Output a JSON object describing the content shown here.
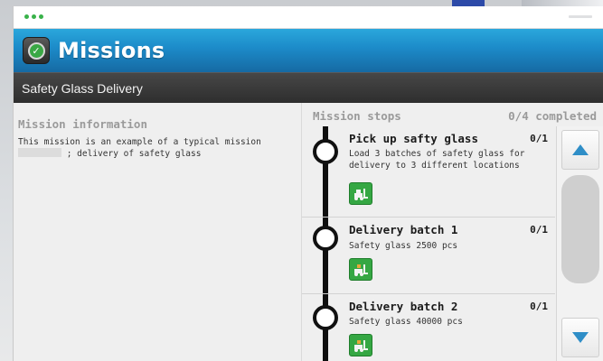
{
  "header": {
    "title": "Missions",
    "icon": "mission-check-icon",
    "accent": "#1c8ac8"
  },
  "subheader": {
    "title": "Safety Glass Delivery"
  },
  "mission_info": {
    "heading": "Mission information",
    "line1": "This mission is an example of a typical mission",
    "line2": "; delivery of safety glass"
  },
  "stops": {
    "heading": "Mission stops",
    "completed": "0/4 completed",
    "items": [
      {
        "title": "Pick up safty glass",
        "count": "0/1",
        "description": "Load 3 batches of safety glass for delivery to 3 different locations",
        "icon": "forklift-load-icon"
      },
      {
        "title": "Delivery batch 1",
        "count": "0/1",
        "description": "Safety glass 2500 pcs",
        "icon": "forklift-unload-icon"
      },
      {
        "title": "Delivery batch 2",
        "count": "0/1",
        "description": "Safety glass 40000 pcs",
        "icon": "forklift-unload-icon"
      }
    ]
  },
  "scrollbar": {
    "up_icon": "triangle-up-icon",
    "down_icon": "triangle-down-icon",
    "accent": "#2f8ec7"
  }
}
